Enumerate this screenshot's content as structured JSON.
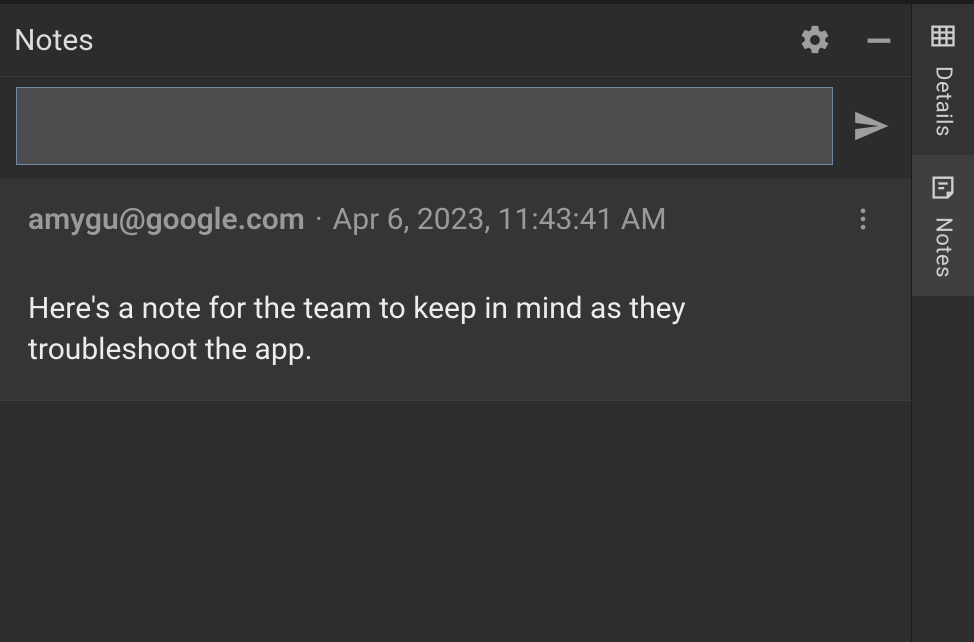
{
  "panel": {
    "title": "Notes"
  },
  "compose": {
    "value": "",
    "placeholder": ""
  },
  "notes": [
    {
      "author": "amygu@google.com",
      "separator": "·",
      "timestamp": "Apr 6, 2023, 11:43:41 AM",
      "body": "Here's a note for the team to keep in mind as they troubleshoot the app."
    }
  ],
  "rail": {
    "tabs": [
      {
        "label": "Details",
        "active": false
      },
      {
        "label": "Notes",
        "active": true
      }
    ]
  },
  "icons": {
    "gear": "gear-icon",
    "minimize": "minimize-icon",
    "send": "send-icon",
    "more": "more-vert-icon",
    "details": "grid-icon",
    "notes": "note-icon"
  }
}
